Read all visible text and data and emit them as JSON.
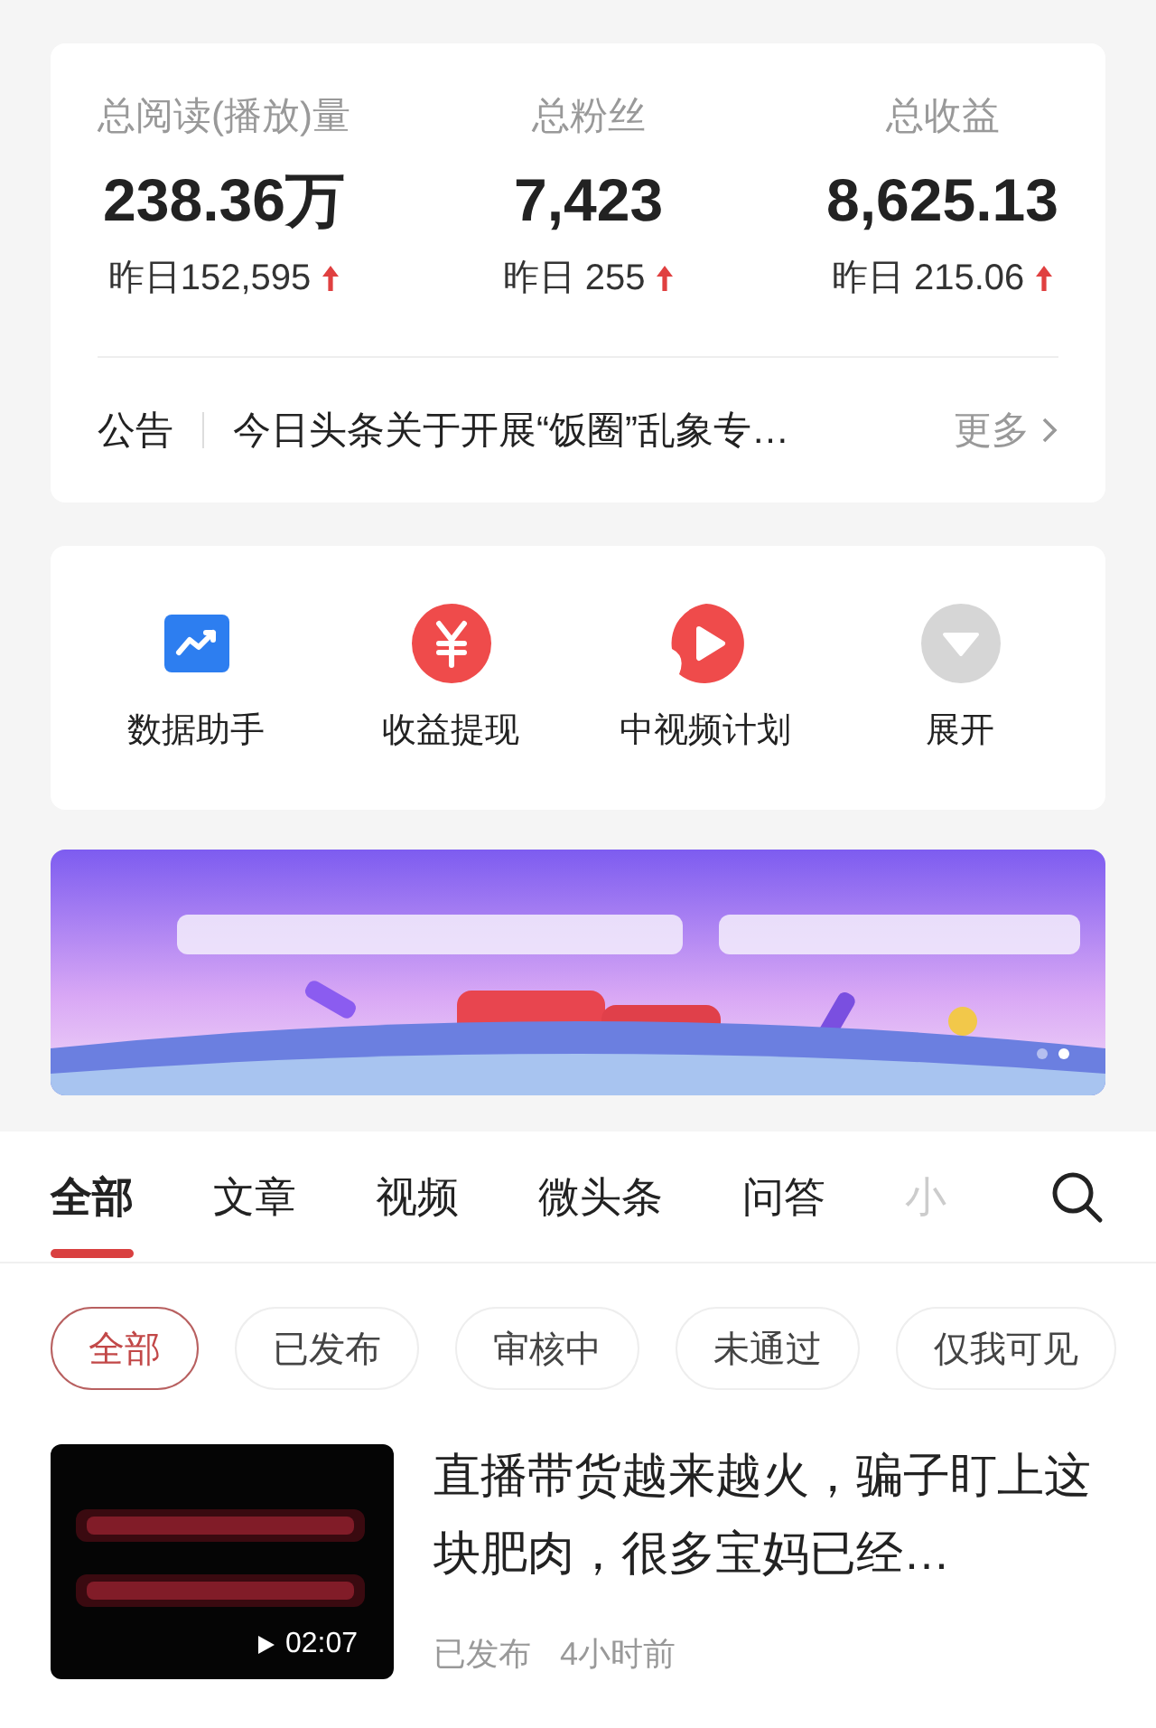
{
  "stats": [
    {
      "label": "总阅读(播放)量",
      "value": "238.36万",
      "yesterday": "昨日152,595",
      "up": true
    },
    {
      "label": "总粉丝",
      "value": "7,423",
      "yesterday": "昨日 255",
      "up": true
    },
    {
      "label": "总收益",
      "value": "8,625.13",
      "yesterday": "昨日 215.06",
      "up": true
    }
  ],
  "notice": {
    "label": "公告",
    "text": "今日头条关于开展“饭圈”乱象专…",
    "more": "更多"
  },
  "tools": [
    {
      "kind": "chart",
      "label": "数据助手"
    },
    {
      "kind": "yuan",
      "label": "收益提现"
    },
    {
      "kind": "play",
      "label": "中视频计划"
    },
    {
      "kind": "expand",
      "label": "展开"
    }
  ],
  "banner": {
    "dots": [
      {
        "selected": false
      },
      {
        "selected": true
      }
    ]
  },
  "tabs": [
    {
      "label": "全部",
      "selected": true
    },
    {
      "label": "文章",
      "selected": false
    },
    {
      "label": "视频",
      "selected": false
    },
    {
      "label": "微头条",
      "selected": false
    },
    {
      "label": "问答",
      "selected": false
    },
    {
      "label": "小",
      "selected": false
    }
  ],
  "filters": [
    {
      "label": "全部",
      "selected": true
    },
    {
      "label": "已发布",
      "selected": false
    },
    {
      "label": "审核中",
      "selected": false
    },
    {
      "label": "未通过",
      "selected": false
    },
    {
      "label": "仅我可见",
      "selected": false
    }
  ],
  "articles": [
    {
      "title": "直播带货越来越火，骗子盯上这块肥肉，很多宝妈已经…",
      "duration": "02:07",
      "status": "已发布",
      "time": "4小时前"
    }
  ]
}
